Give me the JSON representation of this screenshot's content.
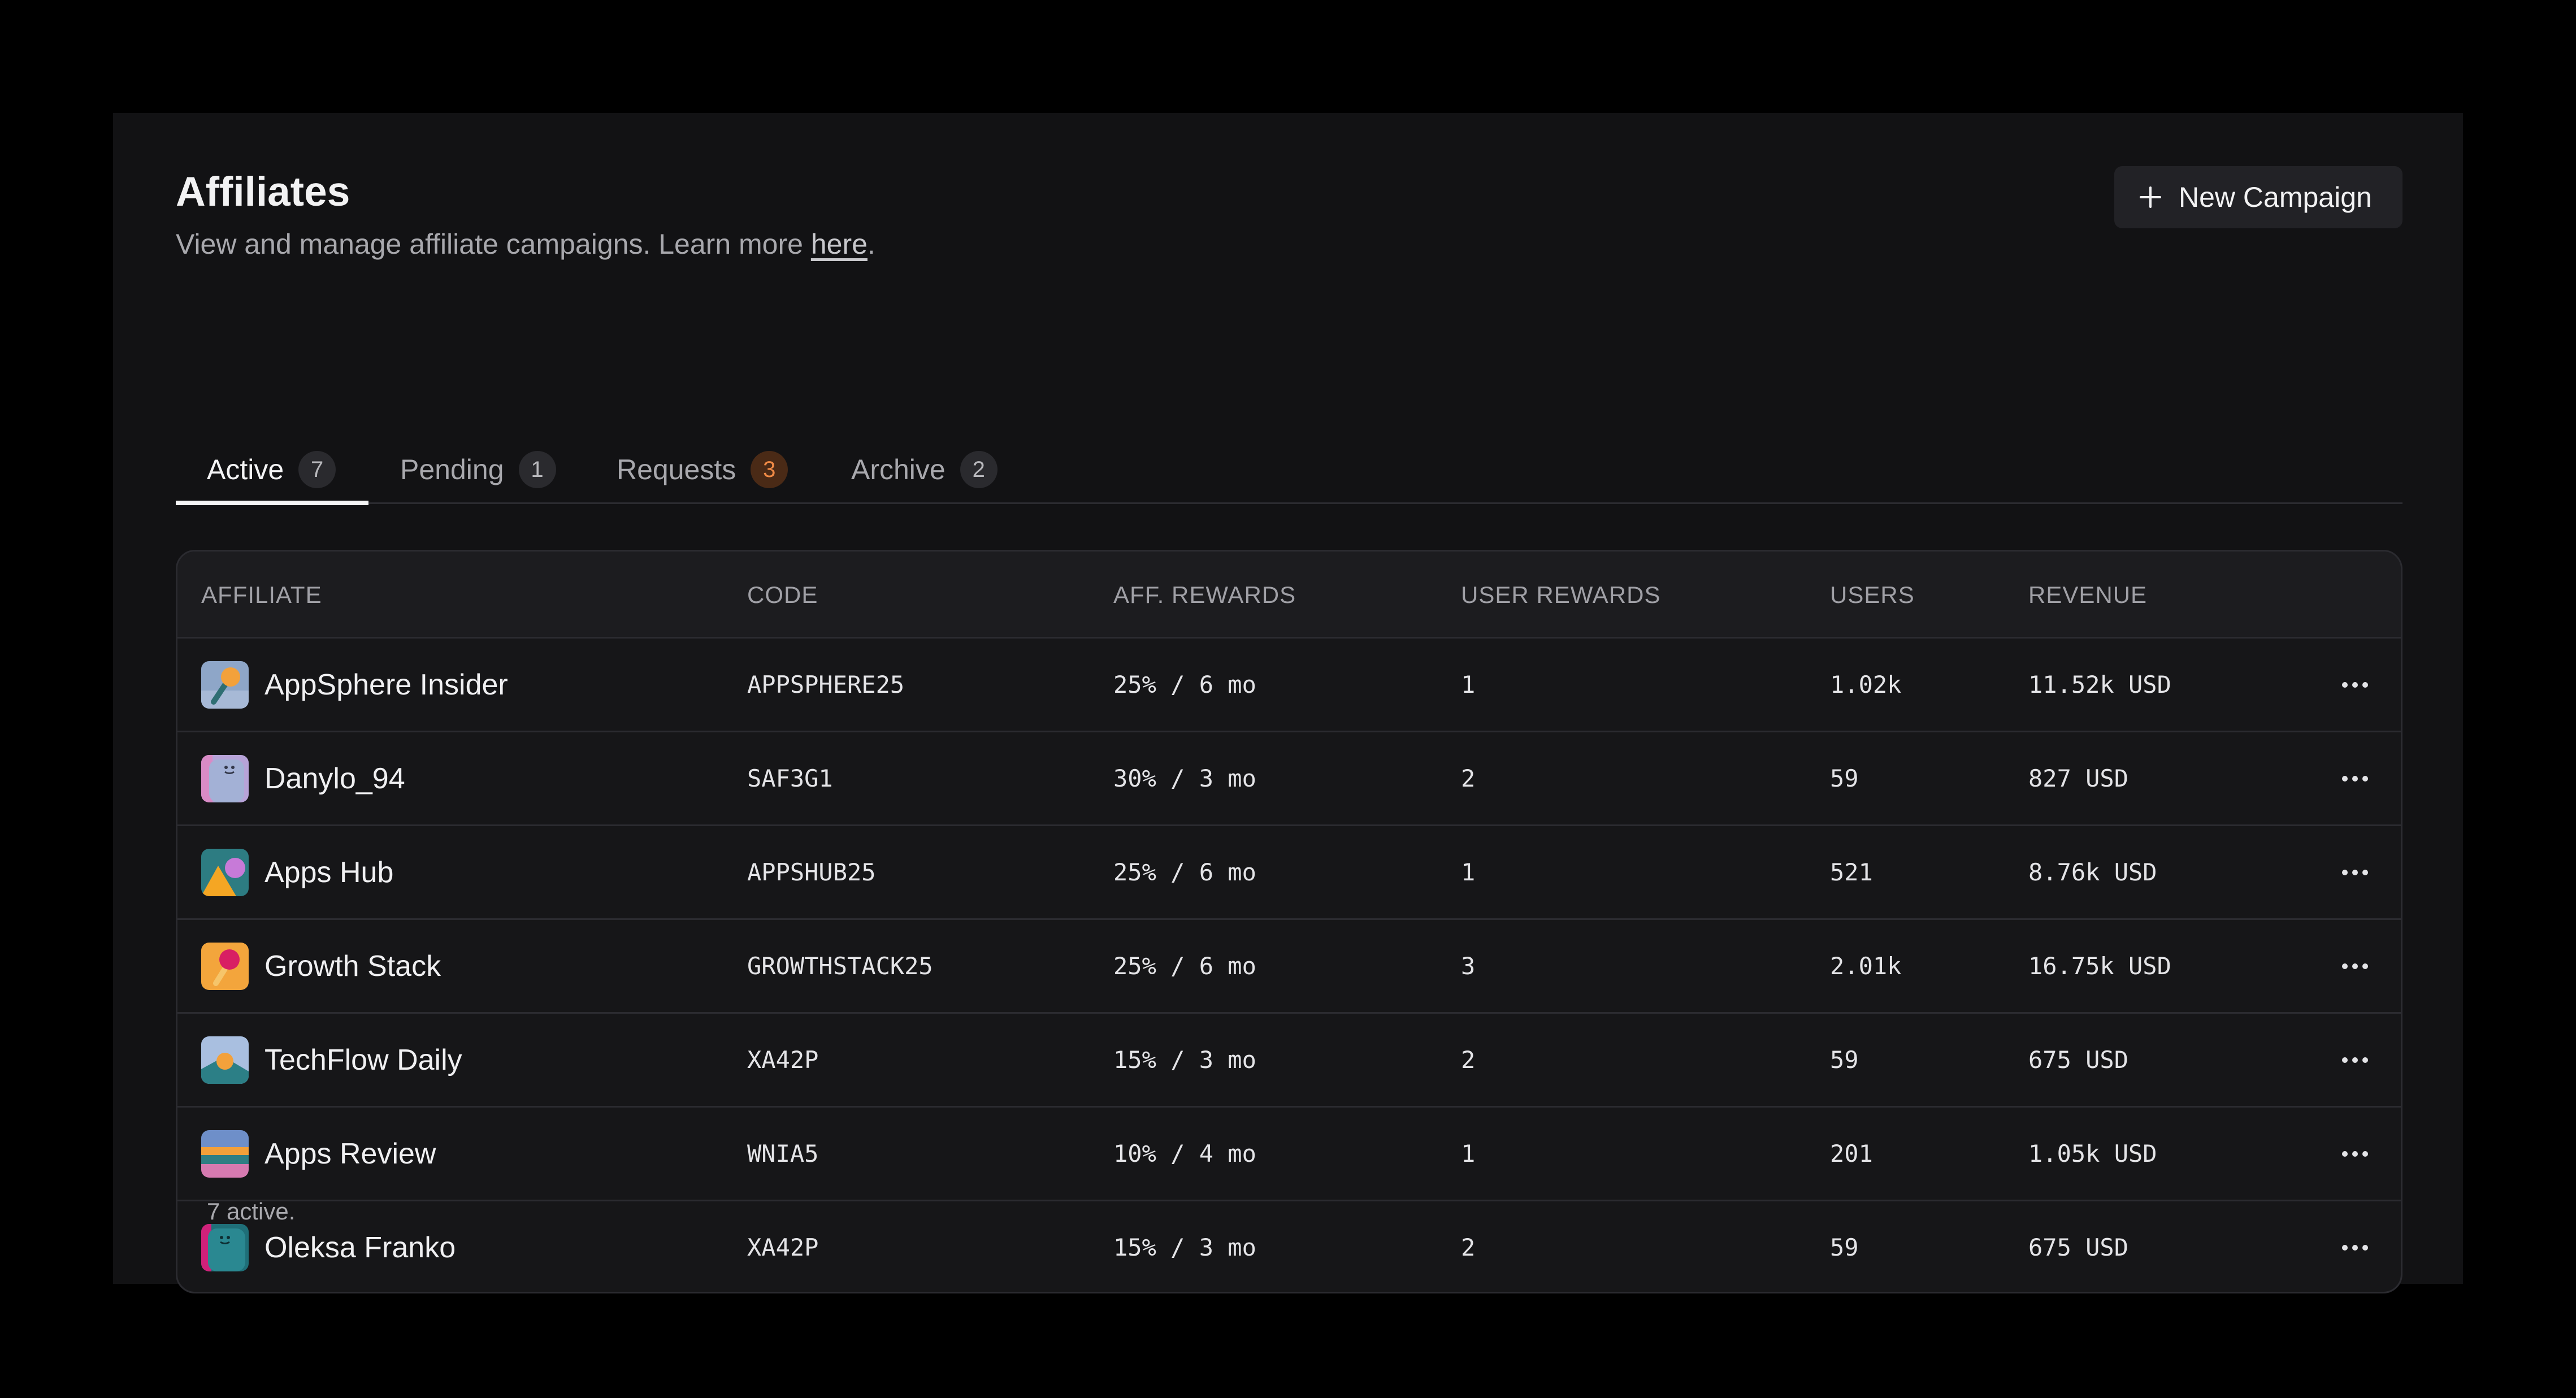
{
  "header": {
    "title": "Affiliates",
    "subtitle_text": "View and manage affiliate campaigns. Learn more ",
    "subtitle_link": "here",
    "subtitle_end": ".",
    "new_campaign_label": "New Campaign"
  },
  "tabs": [
    {
      "label": "Active",
      "count": "7",
      "selected": true
    },
    {
      "label": "Pending",
      "count": "1",
      "selected": false
    },
    {
      "label": "Requests",
      "count": "3",
      "selected": false,
      "badge_color": "#f08a46"
    },
    {
      "label": "Archive",
      "count": "2",
      "selected": false
    }
  ],
  "table": {
    "columns": [
      "AFFILIATE",
      "CODE",
      "AFF. REWARDS",
      "USER REWARDS",
      "USERS",
      "REVENUE"
    ],
    "rows": [
      {
        "affiliate": "AppSphere Insider",
        "avatar": "lollipop-avatar-blue",
        "code": "APPSPHERE25",
        "aff_rewards": "25% / 6 mo",
        "user_rewards": "1",
        "users": "1.02k",
        "revenue": "11.52k USD"
      },
      {
        "affiliate": "Danylo_94",
        "avatar": "face-avatar-lilac",
        "code": "SAF3G1",
        "aff_rewards": "30% / 3 mo",
        "user_rewards": "2",
        "users": "59",
        "revenue": "827 USD"
      },
      {
        "affiliate": "Apps Hub",
        "avatar": "shapes-avatar-teal",
        "code": "APPSHUB25",
        "aff_rewards": "25% / 6 mo",
        "user_rewards": "1",
        "users": "521",
        "revenue": "8.76k USD"
      },
      {
        "affiliate": "Growth Stack",
        "avatar": "lollipop-avatar-orange",
        "code": "GROWTHSTACK25",
        "aff_rewards": "25% / 6 mo",
        "user_rewards": "3",
        "users": "2.01k",
        "revenue": "16.75k USD"
      },
      {
        "affiliate": "TechFlow Daily",
        "avatar": "landscape-avatar-sky",
        "code": "XA42P",
        "aff_rewards": "15% / 3 mo",
        "user_rewards": "2",
        "users": "59",
        "revenue": "675 USD"
      },
      {
        "affiliate": "Apps Review",
        "avatar": "stripes-avatar-sunset",
        "code": "WNIA5",
        "aff_rewards": "10% / 4 mo",
        "user_rewards": "1",
        "users": "201",
        "revenue": "1.05k USD"
      },
      {
        "affiliate": "Oleksa Franko",
        "avatar": "face-avatar-teal",
        "code": "XA42P",
        "aff_rewards": "15% / 3 mo",
        "user_rewards": "2",
        "users": "59",
        "revenue": "675 USD"
      }
    ]
  },
  "footer": {
    "summary": "7 active."
  },
  "colors": {
    "background": "#000000",
    "panel": "#121214",
    "accent_orange": "#f08a46"
  }
}
